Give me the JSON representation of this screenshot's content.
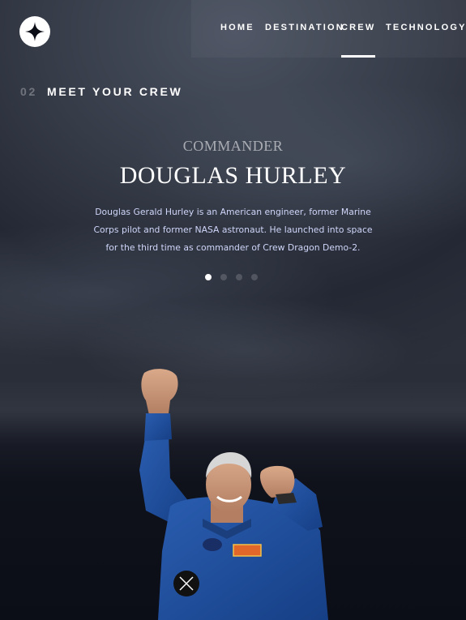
{
  "nav": {
    "items": [
      {
        "label": "HOME"
      },
      {
        "label": "DESTINATION"
      },
      {
        "label": "CREW"
      },
      {
        "label": "TECHNOLOGY"
      }
    ],
    "active": "CREW"
  },
  "section": {
    "number": "02",
    "title": "MEET YOUR CREW"
  },
  "crew": {
    "role": "COMMANDER",
    "name": "DOUGLAS HURLEY",
    "bio": "Douglas Gerald Hurley is an American engineer, former Marine Corps pilot and former NASA astronaut. He launched into space for the third time as commander of Crew Dragon Demo-2."
  },
  "pagination": {
    "count": 4,
    "active_index": 0
  },
  "colors": {
    "background": "#0b0d17",
    "accent_text": "#d0d6f9",
    "suit_blue": "#1f4b96"
  }
}
